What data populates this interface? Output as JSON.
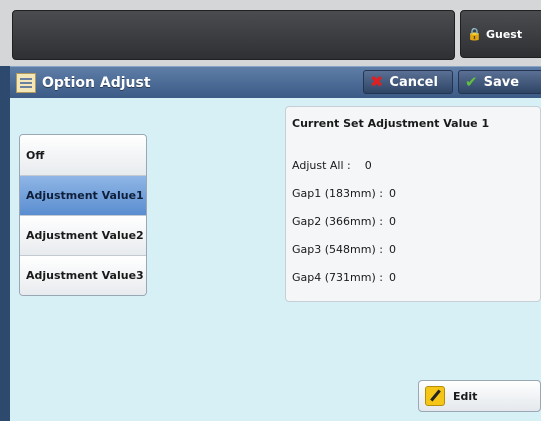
{
  "header": {
    "user_label": "Guest"
  },
  "title_bar": {
    "title": "Option Adjust",
    "cancel_label": "Cancel",
    "save_label": "Save"
  },
  "options": [
    {
      "label": "Off",
      "selected": false
    },
    {
      "label": "Adjustment Value1",
      "selected": true
    },
    {
      "label": "Adjustment Value2",
      "selected": false
    },
    {
      "label": "Adjustment Value3",
      "selected": false
    }
  ],
  "info_panel": {
    "title": "Current Set Adjustment Value 1",
    "rows": [
      {
        "label": "Adjust All :",
        "value": "0"
      },
      {
        "label": "Gap1 (183mm) :",
        "value": "0"
      },
      {
        "label": "Gap2 (366mm) :",
        "value": "0"
      },
      {
        "label": "Gap3 (548mm) :",
        "value": "0"
      },
      {
        "label": "Gap4 (731mm) :",
        "value": "0"
      }
    ]
  },
  "edit_label": "Edit",
  "colors": {
    "title_bar": "#3b5b86",
    "panel_background": "#d6f0f6",
    "selected_option": "#5a8dd0",
    "cancel_icon": "#e02020",
    "save_icon": "#5fc23a",
    "edit_icon": "#f5c518"
  },
  "icons": {
    "user": "lock-user-icon",
    "title": "option-adjust-icon",
    "cancel": "red-x-icon",
    "save": "green-check-icon",
    "edit": "pencil-icon"
  }
}
